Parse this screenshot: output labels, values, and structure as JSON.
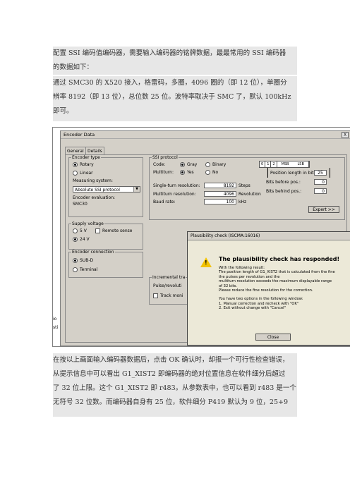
{
  "paragraphs": {
    "p1": [
      "配置 SSI 编码值编码器，需要输入编码器的铭牌数据，最最常用的 SSI 编码器",
      "的数据如下："
    ],
    "p2": [
      "通过 SMC30 的 X520 接入，格雷码，多圈，4096 圈的（即 12 位），单圈分",
      "辨率 8192（即 13 位），总位数 25 位。波特率取决于 SMC 了，默认 100kHz",
      "即可。"
    ],
    "p3": [
      "在按以上画面输入编码器数据后，点击 OK 确认时，却报一个可行性检查错误，",
      "从提示信息中可以看出 G1_XIST2 即编码器的绝对位置信息在软件细分后超过",
      "了 32 位上限。这个 G1_XIST2 即 r483。从参数表中，也可以看到 r483 是一个",
      "无符号 32 位数。而编码器自身有 25 位，软件细分 P419 默认为 9 位，25+9"
    ]
  },
  "window": {
    "title": "Encoder Data",
    "close": "X",
    "tabs": [
      "General",
      "Details"
    ],
    "encoder_type": {
      "legend": "Encoder type",
      "options": [
        "Rotary",
        "Linear"
      ],
      "measuring_label": "Measuring system:",
      "measuring_value": "Absolute SSI protocol",
      "evaluation_label": "Encoder evaluation:",
      "evaluation_value": "SMC30"
    },
    "ssi": {
      "legend": "SSI protocol",
      "code_label": "Code:",
      "code_options": [
        "Gray",
        "Binary"
      ],
      "multiturn_label": "Multiturn:",
      "multiturn_options": [
        "Yes",
        "No"
      ],
      "single_res_label": "Single-turn resolution:",
      "single_res_value": "8192",
      "single_res_unit": "Steps",
      "multi_res_label": "Multiturn resolution:",
      "multi_res_value": "4096",
      "multi_res_unit": "Revolution",
      "baud_label": "Baud rate:",
      "baud_value": "100",
      "baud_unit": "kHz",
      "bits": [
        "0",
        "1",
        "2",
        "MSB",
        "LSB"
      ],
      "pos_len_label": "Position length in bits:",
      "pos_len_value": "25",
      "bits_before_label": "Bits before pos.:",
      "bits_before_value": "0",
      "bits_behind_label": "Bits behind pos.:",
      "bits_behind_value": "0",
      "expert_btn": "Expert >>"
    },
    "supply": {
      "legend": "Supply voltage",
      "options": [
        "5 V",
        "24 V"
      ],
      "remote_sense": "Remote sense"
    },
    "connection": {
      "legend": "Encoder connection",
      "options": [
        "SUB-D",
        "Terminal"
      ]
    },
    "incremental": {
      "legend": "Incremental tra",
      "pulse": "Pulse/revoluti",
      "track": "Track moni"
    }
  },
  "dialog": {
    "title": "Plausibility check (ISCMA:16016)",
    "heading": "The plausibility check has responded!",
    "body": [
      "With the following result:",
      "The position length of G1_XIST2 that is calculated from the fine",
      "the pulses per revolution and the",
      "multiturn resolution exceeds the maximum displayable range",
      "of 32 bits.",
      "Please reduce the fine resolution for the correction.",
      "",
      "You have two options in the following window:",
      "1. Manual correction and recheck with \"OK\"",
      "2. Exit without change with \"Cancel\""
    ],
    "close_btn": "Close"
  },
  "background_text": [
    "io",
    "sti"
  ]
}
